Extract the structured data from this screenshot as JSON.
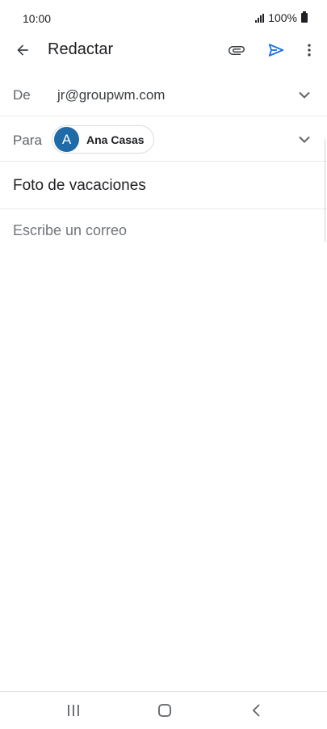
{
  "status_bar": {
    "time": "10:00",
    "battery_text": "100%"
  },
  "toolbar": {
    "title": "Redactar",
    "back_icon": "arrow-left-icon",
    "attach_icon": "paperclip-icon",
    "send_icon": "send-icon",
    "more_icon": "more-vert-icon",
    "accent_color": "#1a73e8"
  },
  "compose": {
    "from_label": "De",
    "from_value": "jr@groupwm.com",
    "to_label": "Para",
    "recipient": {
      "initial": "A",
      "name": "Ana Casas",
      "avatar_color": "#1f6ba8"
    },
    "subject": "Foto de vacaciones",
    "body_placeholder": "Escribe un correo"
  },
  "nav_bar": {
    "recents_icon": "recents-icon",
    "home_icon": "home-icon",
    "back_icon": "back-icon"
  }
}
